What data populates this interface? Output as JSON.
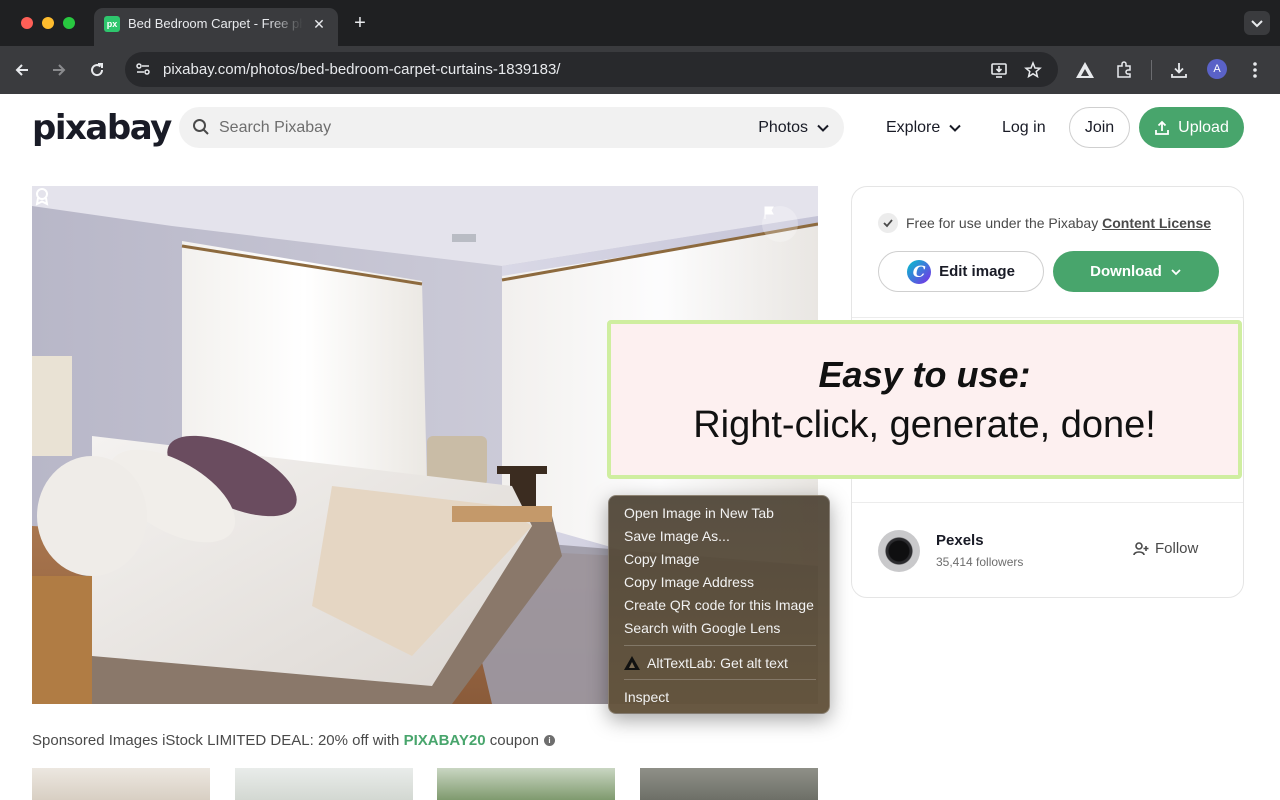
{
  "browser": {
    "tab_title": "Bed Bedroom Carpet - Free photo on Pixabay",
    "tab_favicon": "px",
    "url": "pixabay.com/photos/bed-bedroom-carpet-curtains-1839183/",
    "avatar_letter": "A",
    "icons": [
      "back-icon",
      "forward-icon",
      "reload-icon",
      "site-info-icon",
      "install-icon",
      "bookmark-star-icon",
      "alttextlab-extension-icon",
      "extensions-icon",
      "downloads-icon",
      "more-menu-icon"
    ]
  },
  "header": {
    "logo": "pixabay",
    "search_placeholder": "Search Pixabay",
    "search_type": "Photos",
    "explore": "Explore",
    "login": "Log in",
    "join": "Join",
    "upload": "Upload",
    "accent": "#48a56c"
  },
  "panel": {
    "license_text": "Free for use under the Pixabay ",
    "license_link": "Content License",
    "edit_label": "Edit image",
    "download_label": "Download",
    "author_name": "Pexels",
    "author_followers": "35,414 followers",
    "follow_label": "Follow"
  },
  "banner": {
    "line1": "Easy to use:",
    "line2": "Right-click, generate, done!",
    "border_color": "#cfeea0",
    "background": "#fdf0f0"
  },
  "context_menu": {
    "items": [
      "Open Image in New Tab",
      "Save Image As...",
      "Copy Image",
      "Copy Image Address",
      "Create QR code for this Image",
      "Search with Google Lens"
    ],
    "extension_item": "AltTextLab: Get alt text",
    "inspect": "Inspect"
  },
  "sponsored": {
    "text": "Sponsored Images iStock LIMITED DEAL: 20% off with ",
    "coupon": "PIXABAY20",
    "suffix": " coupon"
  }
}
